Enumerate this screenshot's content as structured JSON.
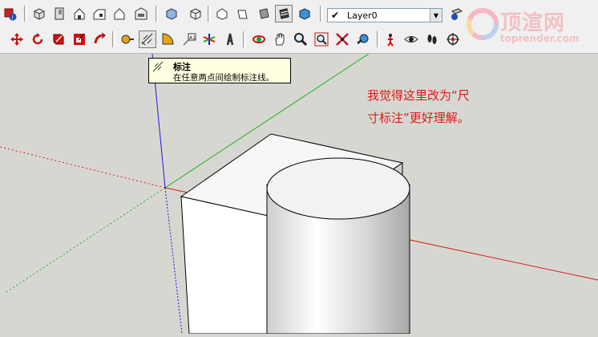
{
  "toolbar": {
    "row1": [
      {
        "name": "component-info-icon"
      },
      {
        "name": "sep"
      },
      {
        "name": "iso-view-icon"
      },
      {
        "name": "top-view-icon"
      },
      {
        "name": "front-view-icon"
      },
      {
        "name": "right-view-icon"
      },
      {
        "name": "back-view-icon"
      },
      {
        "name": "left-view-icon"
      },
      {
        "name": "sep"
      },
      {
        "name": "xray-style-icon"
      },
      {
        "name": "wireframe-style-icon"
      },
      {
        "name": "hidden-line-style-icon"
      },
      {
        "name": "shaded-style-icon"
      },
      {
        "name": "shaded-texture-style-icon"
      },
      {
        "name": "monochrome-style-icon"
      },
      {
        "name": "sep"
      }
    ],
    "row2": [
      {
        "name": "move-icon"
      },
      {
        "name": "rotate-icon"
      },
      {
        "name": "scale-icon"
      },
      {
        "name": "offset-icon"
      },
      {
        "name": "sep"
      },
      {
        "name": "tape-measure-icon"
      },
      {
        "name": "dimension-icon"
      },
      {
        "name": "protractor-icon"
      },
      {
        "name": "text-icon"
      },
      {
        "name": "axes-icon"
      },
      {
        "name": "3d-text-icon"
      },
      {
        "name": "sep"
      },
      {
        "name": "orbit-icon"
      },
      {
        "name": "pan-icon"
      },
      {
        "name": "zoom-icon"
      },
      {
        "name": "zoom-window-icon"
      },
      {
        "name": "zoom-extents-icon"
      },
      {
        "name": "previous-view-icon"
      },
      {
        "name": "sep"
      },
      {
        "name": "position-camera-icon"
      },
      {
        "name": "look-around-icon"
      },
      {
        "name": "walk-icon"
      },
      {
        "name": "section-plane-icon"
      }
    ]
  },
  "layer": {
    "checkmark": "✔",
    "current": "Layer0"
  },
  "tooltip": {
    "title": "标注",
    "description": "在任意两点间绘制标注线。"
  },
  "note": {
    "line1": "我觉得这里改为“尺",
    "line2": "寸标注”更好理解。"
  },
  "watermark": {
    "title": "顶渲网",
    "url": "toprender.com"
  },
  "colors": {
    "x_axis": "#d62020",
    "y_axis": "#1eb01e",
    "z_axis": "#1a1ad6",
    "note_text": "#e01818",
    "tooltip_bg": "#ffffe1"
  }
}
